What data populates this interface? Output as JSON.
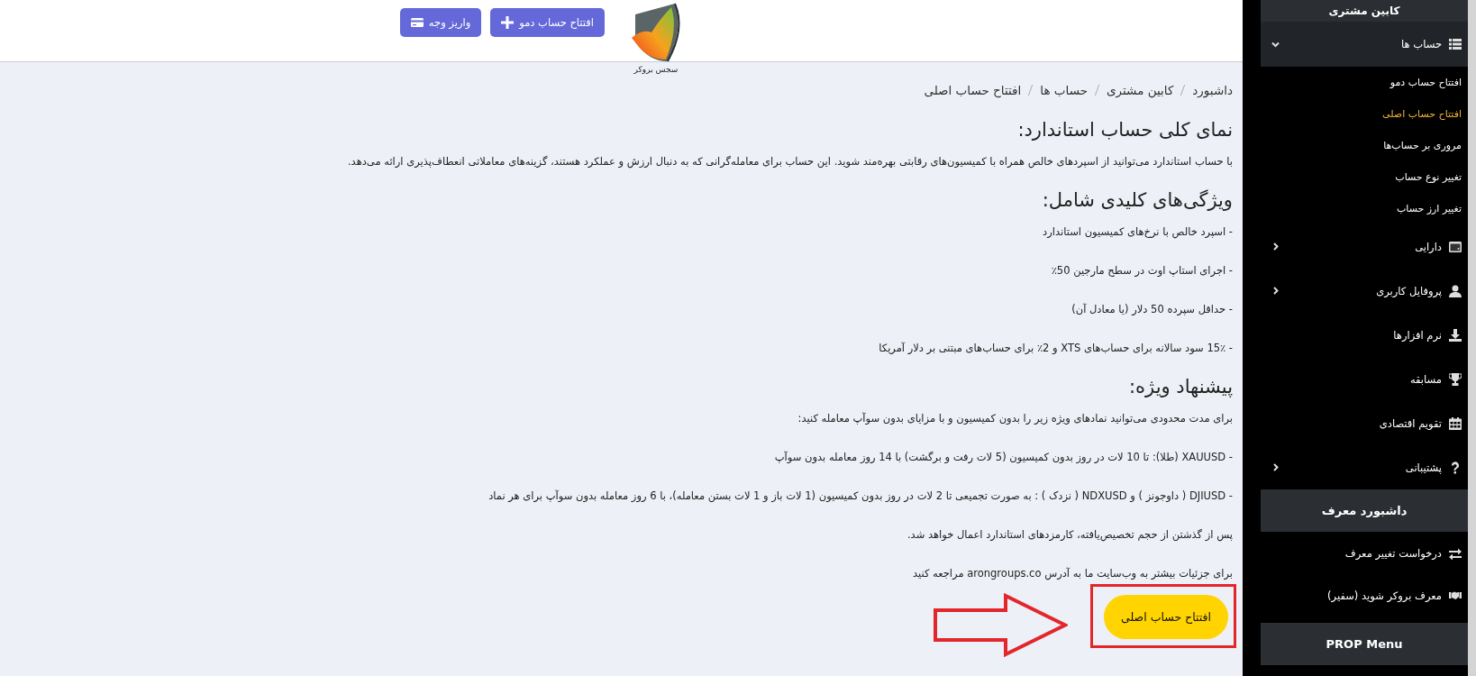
{
  "header": {
    "logo_caption": "سجس بروکر",
    "buttons": [
      {
        "kind": "add",
        "label": "افتتاح حساب دمو"
      },
      {
        "kind": "card",
        "label": "واریز وجه"
      }
    ]
  },
  "breadcrumb": [
    "داشبورد",
    "کابین مشتری",
    "حساب ها",
    "افتتاح حساب اصلی"
  ],
  "article": [
    {
      "kind": "heading",
      "text": "نمای کلی حساب استاندارد:"
    },
    {
      "kind": "paragraph",
      "text": "با حساب استاندارد می‌توانید از اسپردهای خالص همراه با کمیسیون‌های رقابتی بهره‌مند شوید. این حساب برای معامله‌گرانی که به دنبال ارزش و عملکرد هستند، گزینه‌های معاملاتی انعطاف‌پذیری ارائه می‌دهد."
    },
    {
      "kind": "heading",
      "text": "ویژگی‌های کلیدی شامل:"
    },
    {
      "kind": "paragraph",
      "text": "- اسپرد خالص با نرخ‌های کمیسیون استاندارد"
    },
    {
      "kind": "paragraph",
      "text": "- اجرای استاپ اوت در سطح مارجین 50٪"
    },
    {
      "kind": "paragraph",
      "text": "- حداقل سپرده 50 دلار (یا معادل آن)"
    },
    {
      "kind": "paragraph",
      "text": "- 15٪ سود سالانه برای حساب‌های XTS و 2٪ برای حساب‌های مبتنی بر دلار آمریکا"
    },
    {
      "kind": "heading",
      "text": "پیشنهاد ویژه:"
    },
    {
      "kind": "paragraph",
      "text": "برای مدت محدودی می‌توانید نمادهای ویژه زیر را بدون کمیسیون و با مزایای بدون سوآپ معامله کنید:"
    },
    {
      "kind": "paragraph",
      "text": "- XAUUSD (طلا): تا 10 لات در روز بدون کمیسیون (5 لات رفت و برگشت) با 14 روز معامله بدون سوآپ"
    },
    {
      "kind": "paragraph",
      "text": "- DJIUSD ( داوجونز ) و NDXUSD ( نزدک ) : به صورت تجمیعی تا 2 لات در روز بدون کمیسیون (1 لات باز و 1 لات بستن معامله)، با 6 روز معامله بدون سوآپ برای هر نماد"
    },
    {
      "kind": "paragraph",
      "text": "پس از گذشتن از حجم تخصیص‌یافته، کارمزدهای استاندارد اعمال خواهد شد."
    },
    {
      "kind": "paragraph",
      "text": "برای جزئیات بیشتر به وب‌سایت ما به آدرس arongroups.co مراجعه کنید"
    }
  ],
  "cta": {
    "label": "افتتاح حساب اصلی"
  },
  "sidebar": {
    "sections": [
      {
        "title": "کابین مشتری",
        "items": [
          {
            "kind": "menu",
            "label": "حساب ها",
            "expanded": true,
            "children": [
              {
                "label": "افتتاح حساب دمو",
                "selected": false
              },
              {
                "label": "افتتاح حساب اصلی",
                "selected": true
              },
              {
                "label": "مروری بر حساب‌ها",
                "selected": false
              },
              {
                "label": "تغییر نوع حساب",
                "selected": false
              },
              {
                "label": "تغییر ارز حساب",
                "selected": false
              }
            ]
          },
          {
            "kind": "wallet",
            "label": "دارایی",
            "expanded": false
          },
          {
            "kind": "user",
            "label": "پروفایل کاربری",
            "expanded": false
          },
          {
            "kind": "download",
            "label": "نرم افزارها"
          },
          {
            "kind": "trophy",
            "label": "مسابقه"
          },
          {
            "kind": "calendar",
            "label": "تقویم اقتصادی"
          },
          {
            "kind": "help",
            "label": "پشتیبانی",
            "expanded": false
          }
        ]
      },
      {
        "title": "داشبورد معرف",
        "items": [
          {
            "kind": "exchange",
            "label": "درخواست تغییر معرف"
          },
          {
            "kind": "handshake",
            "label": "معرف بروکر شوید (سفیر)"
          }
        ]
      },
      {
        "title": "PROP Menu"
      }
    ]
  }
}
